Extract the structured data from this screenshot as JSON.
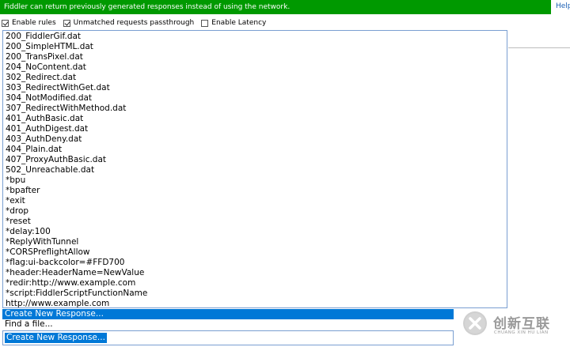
{
  "banner": {
    "text": "Fiddler can return previously generated responses instead of using the network.",
    "help": "Help"
  },
  "options": [
    {
      "label": "Enable rules",
      "checked": true
    },
    {
      "label": "Unmatched requests passthrough",
      "checked": true
    },
    {
      "label": "Enable Latency",
      "checked": false
    }
  ],
  "dropdown": {
    "items": [
      "200_FiddlerGif.dat",
      "200_SimpleHTML.dat",
      "200_TransPixel.dat",
      "204_NoContent.dat",
      "302_Redirect.dat",
      "303_RedirectWithGet.dat",
      "304_NotModified.dat",
      "307_RedirectWithMethod.dat",
      "401_AuthBasic.dat",
      "401_AuthDigest.dat",
      "403_AuthDeny.dat",
      "404_Plain.dat",
      "407_ProxyAuthBasic.dat",
      "502_Unreachable.dat",
      "*bpu",
      "*bpafter",
      "*exit",
      "*drop",
      "*reset",
      "*delay:100",
      "*ReplyWithTunnel",
      "*CORSPreflightAllow",
      "*flag:ui-backcolor=#FFD700",
      "*header:HeaderName=NewValue",
      "*redir:http://www.example.com",
      "*script:FiddlerScriptFunctionName",
      "http://www.example.com"
    ],
    "selected": "Create New Response...",
    "find": "Find a file..."
  },
  "combo": {
    "value": "Create New Response..."
  },
  "watermark": {
    "cn": "创新互联",
    "en": "CHUANG XIN HU LIAN"
  }
}
